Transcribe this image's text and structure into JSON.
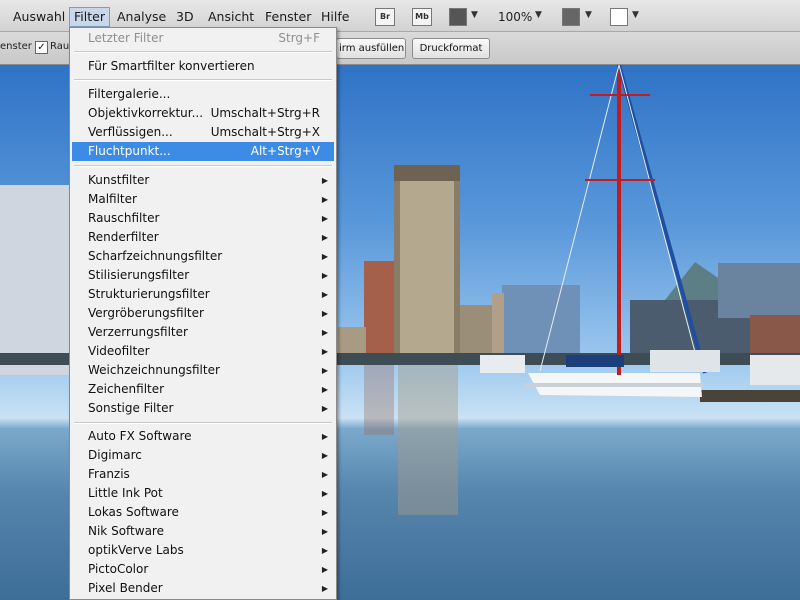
{
  "menubar": {
    "items": [
      "Auswahl",
      "Filter",
      "Analyse",
      "3D",
      "Ansicht",
      "Fenster",
      "Hilfe"
    ],
    "active": "Filter",
    "br_label": "Br",
    "mb_label": "Mb",
    "zoom": "100%"
  },
  "options": {
    "left_text": "enster",
    "checkbox_label": "Rau",
    "fill_button": "irm ausfüllen",
    "print_button": "Druckformat"
  },
  "filter_menu": {
    "last_filter": {
      "label": "Letzter Filter",
      "shortcut": "Strg+F"
    },
    "smart_convert": "Für Smartfilter konvertieren",
    "gallery": {
      "label": "Filtergalerie..."
    },
    "lens": {
      "label": "Objektivkorrektur...",
      "shortcut": "Umschalt+Strg+R"
    },
    "liquify": {
      "label": "Verflüssigen...",
      "shortcut": "Umschalt+Strg+X"
    },
    "vanishing": {
      "label": "Fluchtpunkt...",
      "shortcut": "Alt+Strg+V"
    },
    "submenus": [
      "Kunstfilter",
      "Malfilter",
      "Rauschfilter",
      "Renderfilter",
      "Scharfzeichnungsfilter",
      "Stilisierungsfilter",
      "Strukturierungsfilter",
      "Vergröberungsfilter",
      "Verzerrungsfilter",
      "Videofilter",
      "Weichzeichnungsfilter",
      "Zeichenfilter",
      "Sonstige Filter"
    ],
    "plugins": [
      "Auto FX Software",
      "Digimarc",
      "Franzis",
      "Little Ink Pot",
      "Lokas Software",
      "Nik Software",
      "optikVerve Labs",
      "PictoColor",
      "Pixel Bender"
    ]
  },
  "colors": {
    "highlight": "#3c8ce6",
    "menu_bg": "#f1f1f1"
  }
}
